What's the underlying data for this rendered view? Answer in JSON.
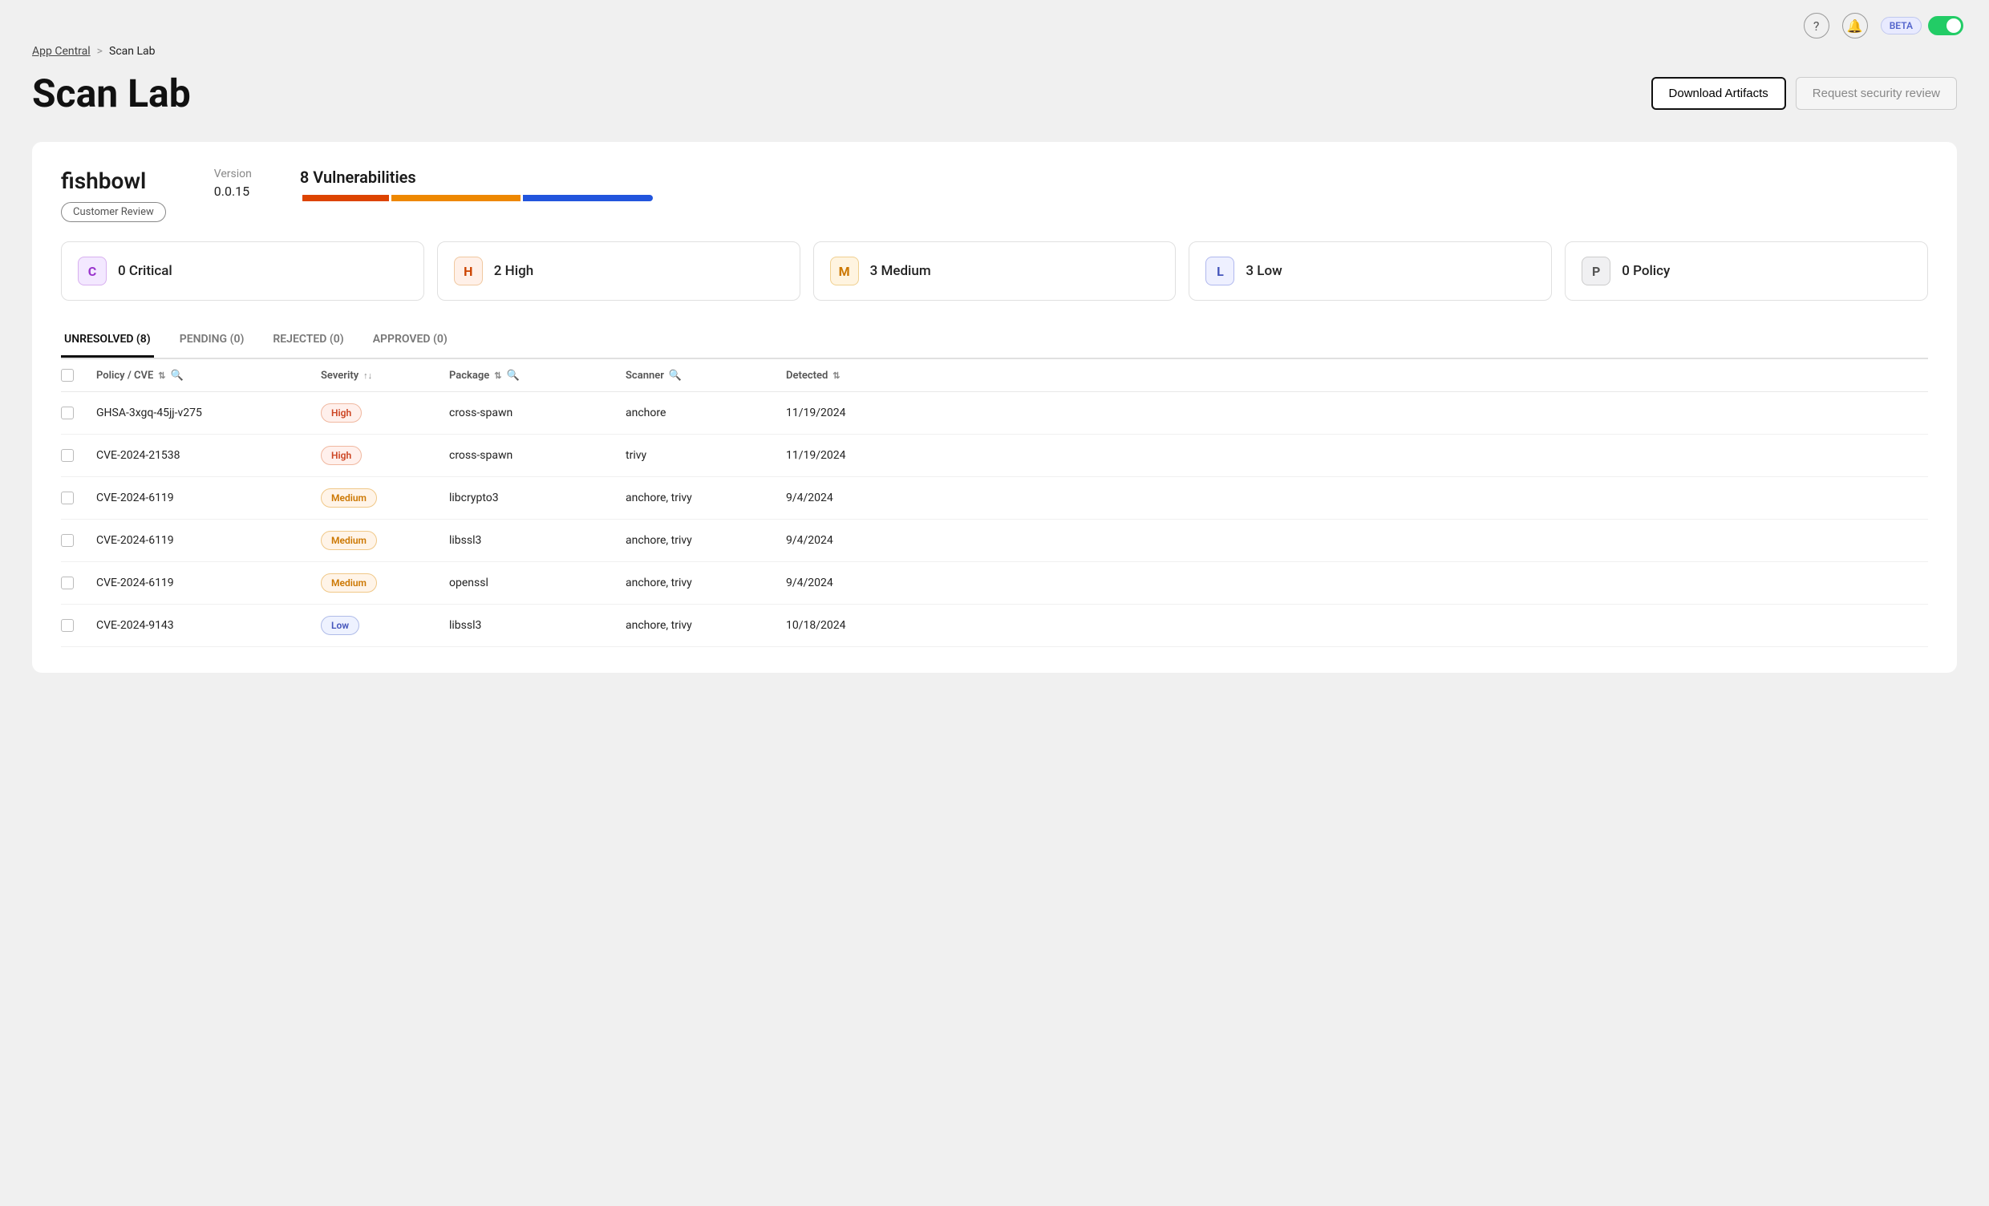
{
  "topbar": {
    "help_icon": "?",
    "bell_icon": "🔔",
    "beta_label": "BETA"
  },
  "breadcrumb": {
    "parent": "App Central",
    "separator": ">",
    "current": "Scan Lab"
  },
  "page": {
    "title": "Scan Lab",
    "download_btn": "Download Artifacts",
    "review_btn": "Request security review"
  },
  "app": {
    "name": "fishbowl",
    "badge": "Customer Review",
    "version_label": "Version",
    "version": "0.0.15",
    "vuln_title": "8 Vulnerabilities"
  },
  "severity_cards": [
    {
      "id": "critical",
      "letter": "C",
      "label": "0 Critical"
    },
    {
      "id": "high",
      "letter": "H",
      "label": "2 High"
    },
    {
      "id": "medium",
      "letter": "M",
      "label": "3 Medium"
    },
    {
      "id": "low",
      "letter": "L",
      "label": "3 Low"
    },
    {
      "id": "policy",
      "letter": "P",
      "label": "0 Policy"
    }
  ],
  "tabs": [
    {
      "id": "unresolved",
      "label": "UNRESOLVED (8)",
      "active": true
    },
    {
      "id": "pending",
      "label": "PENDING (0)",
      "active": false
    },
    {
      "id": "rejected",
      "label": "REJECTED (0)",
      "active": false
    },
    {
      "id": "approved",
      "label": "APPROVED (0)",
      "active": false
    }
  ],
  "table": {
    "columns": [
      {
        "id": "checkbox",
        "label": ""
      },
      {
        "id": "policy",
        "label": "Policy / CVE",
        "sortable": true,
        "searchable": true
      },
      {
        "id": "severity",
        "label": "Severity",
        "sortable": true
      },
      {
        "id": "package",
        "label": "Package",
        "sortable": true,
        "searchable": true
      },
      {
        "id": "scanner",
        "label": "Scanner",
        "searchable": true
      },
      {
        "id": "detected",
        "label": "Detected",
        "sortable": true
      }
    ],
    "rows": [
      {
        "cve": "GHSA-3xgq-45jj-v275",
        "severity": "High",
        "severity_class": "high",
        "package": "cross-spawn",
        "scanner": "anchore",
        "detected": "11/19/2024"
      },
      {
        "cve": "CVE-2024-21538",
        "severity": "High",
        "severity_class": "high",
        "package": "cross-spawn",
        "scanner": "trivy",
        "detected": "11/19/2024"
      },
      {
        "cve": "CVE-2024-6119",
        "severity": "Medium",
        "severity_class": "medium",
        "package": "libcrypto3",
        "scanner": "anchore, trivy",
        "detected": "9/4/2024"
      },
      {
        "cve": "CVE-2024-6119",
        "severity": "Medium",
        "severity_class": "medium",
        "package": "libssl3",
        "scanner": "anchore, trivy",
        "detected": "9/4/2024"
      },
      {
        "cve": "CVE-2024-6119",
        "severity": "Medium",
        "severity_class": "medium",
        "package": "openssl",
        "scanner": "anchore, trivy",
        "detected": "9/4/2024"
      },
      {
        "cve": "CVE-2024-9143",
        "severity": "Low",
        "severity_class": "low",
        "package": "libssl3",
        "scanner": "anchore, trivy",
        "detected": "10/18/2024"
      }
    ]
  }
}
